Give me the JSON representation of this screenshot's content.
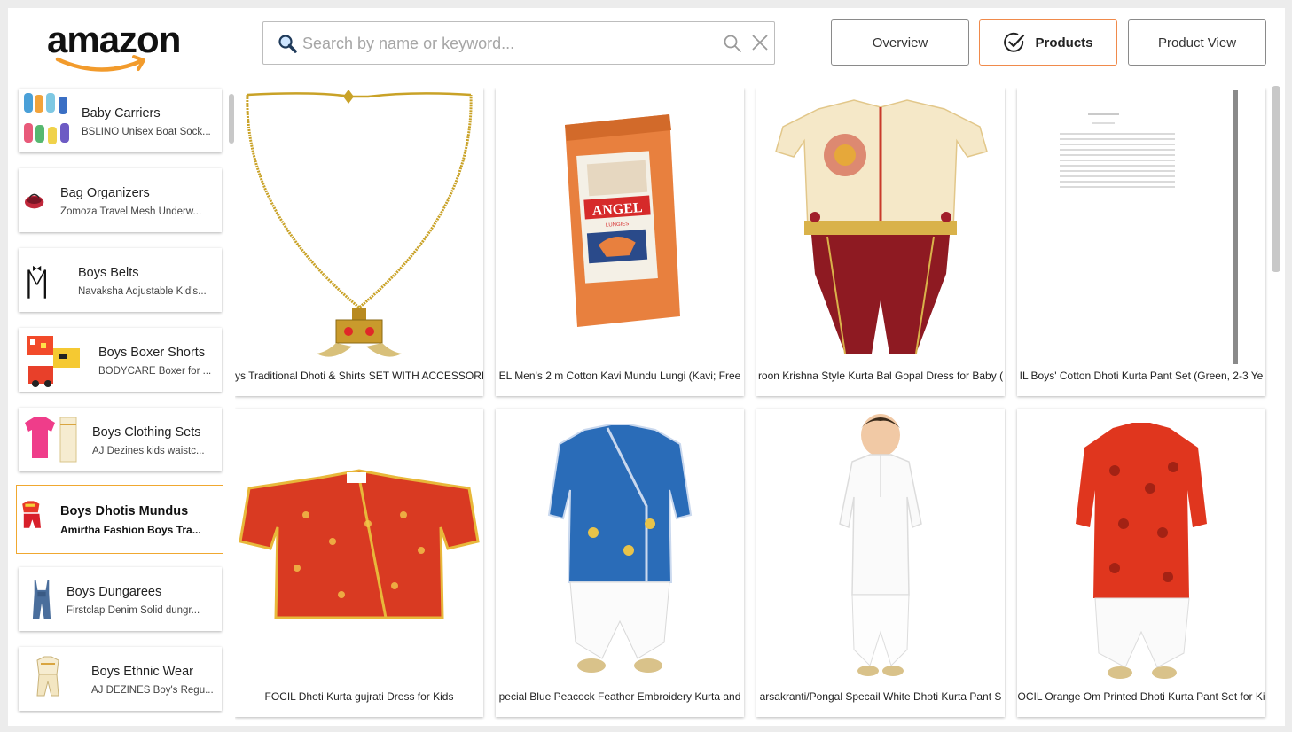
{
  "brand": {
    "logo_text": "amazon",
    "logo_icon": "amazon-smile-icon",
    "accent": "#f08a4b",
    "arrow": "#f29b2c"
  },
  "search": {
    "placeholder": "Search by name or keyword...",
    "value": ""
  },
  "nav": {
    "overview": "Overview",
    "products": "Products",
    "product_view": "Product View",
    "active": "Products"
  },
  "categories": [
    {
      "name": "Baby Carriers",
      "sub": "BSLINO Unisex Boat Sock..."
    },
    {
      "name": "Bag Organizers",
      "sub": "Zomoza Travel Mesh Underw..."
    },
    {
      "name": "Boys Belts",
      "sub": "Navaksha Adjustable Kid's..."
    },
    {
      "name": "Boys Boxer Shorts",
      "sub": "BODYCARE Boxer for ..."
    },
    {
      "name": "Boys Clothing Sets",
      "sub": "AJ Dezines kids waistc..."
    },
    {
      "name": "Boys Dhotis Mundus",
      "sub": "Amirtha Fashion Boys Tra...",
      "selected": true
    },
    {
      "name": "Boys Dungarees",
      "sub": "Firstclap Denim Solid dungr..."
    },
    {
      "name": "Boys Ethnic Wear",
      "sub": "AJ DEZINES Boy's Regu..."
    }
  ],
  "products": [
    {
      "title": "ys Traditional Dhoti & Shirts SET WITH ACCESSORIE"
    },
    {
      "title": "EL Men's 2 m Cotton Kavi Mundu Lungi (Kavi; Free"
    },
    {
      "title": "roon Krishna Style Kurta Bal Gopal Dress for Baby ("
    },
    {
      "title": "IL Boys' Cotton Dhoti Kurta Pant Set (Green, 2-3 Ye"
    },
    {
      "title": "FOCIL Dhoti Kurta gujrati Dress for Kids"
    },
    {
      "title": "pecial Blue Peacock Feather Embroidery Kurta and"
    },
    {
      "title": "arsakranti/Pongal Specail White Dhoti Kurta Pant S"
    },
    {
      "title": "OCIL Orange Om Printed Dhoti Kurta Pant Set for Ki"
    }
  ],
  "product_images": {
    "lungi_label": "ANGEL",
    "lungi_sublabel": "LUNGIES"
  }
}
